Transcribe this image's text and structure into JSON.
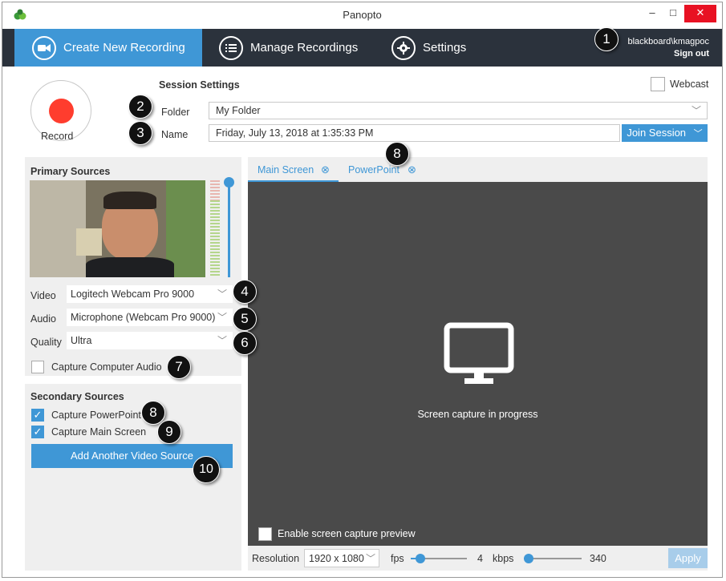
{
  "window": {
    "title": "Panopto",
    "minimize": "–",
    "maximize": "□",
    "close": "✕"
  },
  "nav": {
    "tabs": [
      {
        "label": "Create New Recording",
        "icon": "video-camera-icon"
      },
      {
        "label": "Manage Recordings",
        "icon": "list-icon"
      },
      {
        "label": "Settings",
        "icon": "gear-icon"
      }
    ],
    "user": "blackboard\\kmagpoc",
    "sign_out": "Sign out"
  },
  "session": {
    "heading": "Session Settings",
    "record_label": "Record",
    "folder_label": "Folder",
    "folder_value": "My Folder",
    "name_label": "Name",
    "name_value": "Friday, July 13, 2018 at 1:35:33 PM",
    "join_session": "Join Session",
    "webcast_label": "Webcast"
  },
  "primary": {
    "heading": "Primary Sources",
    "video_label": "Video",
    "video_value": "Logitech Webcam Pro 9000",
    "audio_label": "Audio",
    "audio_value": "Microphone (Webcam Pro 9000)",
    "quality_label": "Quality",
    "quality_value": "Ultra",
    "capture_audio_label": "Capture Computer Audio",
    "capture_audio_checked": false
  },
  "secondary": {
    "heading": "Secondary Sources",
    "capture_ppt_label": "Capture PowerPoint",
    "capture_ppt_checked": true,
    "capture_main_label": "Capture Main Screen",
    "capture_main_checked": true,
    "add_source": "Add Another Video Source"
  },
  "preview": {
    "tabs": [
      {
        "label": "Main Screen"
      },
      {
        "label": "PowerPoint"
      }
    ],
    "status": "Screen capture in progress",
    "enable_preview_label": "Enable screen capture preview",
    "resolution_label": "Resolution",
    "resolution_value": "1920 x 1080",
    "fps_label": "fps",
    "fps_value": "4",
    "kbps_label": "kbps",
    "kbps_value": "340",
    "apply": "Apply"
  },
  "callouts": [
    "1",
    "2",
    "3",
    "4",
    "5",
    "6",
    "7",
    "8",
    "8",
    "9",
    "10"
  ],
  "colors": {
    "accent": "#3f97d6",
    "nav_bg": "#2b323c",
    "record": "#ff3d2e",
    "preview_bg": "#4a4a4a"
  }
}
